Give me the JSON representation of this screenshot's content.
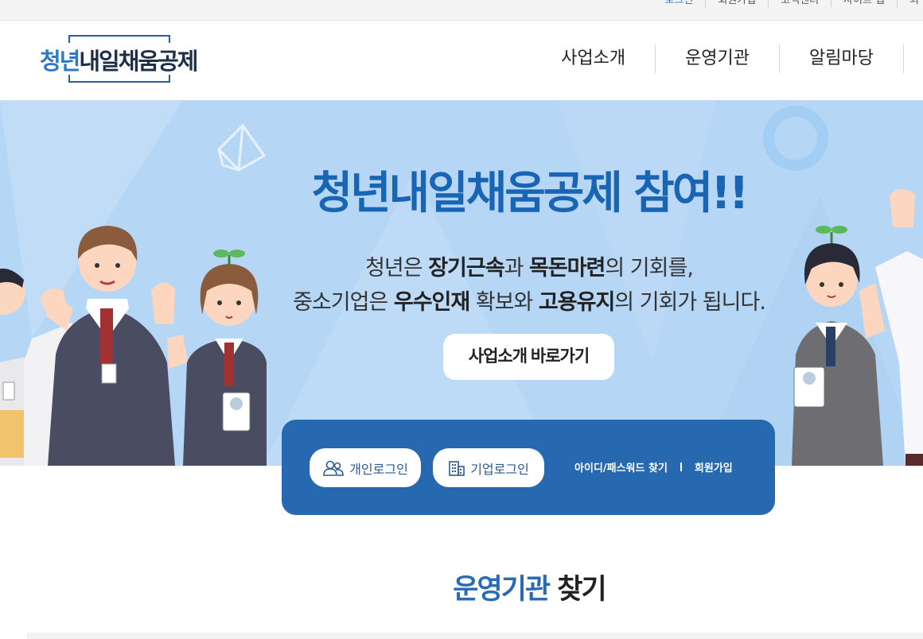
{
  "util_nav": [
    "로그인",
    "회원가입",
    "고객센터",
    "사이트 맵",
    "외"
  ],
  "logo": {
    "part1": "청년",
    "part2": "내일채움공제"
  },
  "gnb": [
    "사업소개",
    "운영기관",
    "알림마당"
  ],
  "hero": {
    "title": "청년내일채움공제 참여!!",
    "line1": {
      "t1": "청년은 ",
      "b1": "장기근속",
      "t2": "과 ",
      "b2": "목돈마련",
      "t3": "의 기회를,"
    },
    "line2": {
      "t1": "중소기업은 ",
      "b1": "우수인재",
      "t2": " 확보와 ",
      "b2": "고용유지",
      "t3": "의 기회가 됩니다."
    },
    "button": "사업소개 바로가기"
  },
  "login": {
    "personal": "개인로그인",
    "company": "기업로그인",
    "find": "아이디/패스워드 찾기",
    "join": "회원가입",
    "icons": {
      "personal": "people-icon",
      "company": "building-icon"
    }
  },
  "section": {
    "part1": "운영기관",
    "part2": " 찾기"
  },
  "colors": {
    "primary": "#2769b0",
    "hero_bg": "#b6d6f6",
    "title_blue": "#1a64b4"
  }
}
